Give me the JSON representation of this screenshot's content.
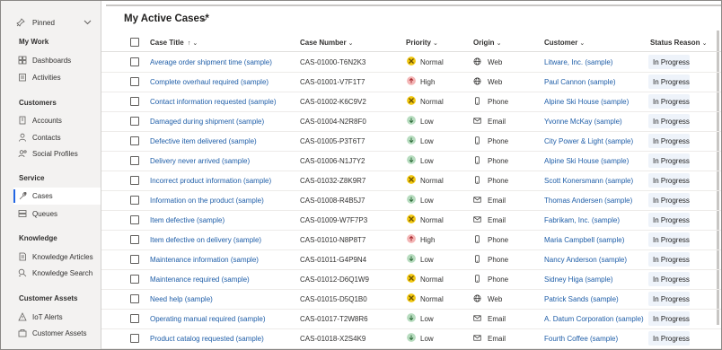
{
  "sidebar": {
    "pinned_label": "Pinned",
    "groups": [
      {
        "label": "My Work",
        "items": [
          {
            "label": "Dashboards",
            "icon": "dashboard-icon"
          },
          {
            "label": "Activities",
            "icon": "activities-icon"
          }
        ]
      },
      {
        "label": "Customers",
        "items": [
          {
            "label": "Accounts",
            "icon": "building-icon"
          },
          {
            "label": "Contacts",
            "icon": "person-icon"
          },
          {
            "label": "Social Profiles",
            "icon": "social-profile-icon"
          }
        ]
      },
      {
        "label": "Service",
        "items": [
          {
            "label": "Cases",
            "icon": "wrench-icon",
            "active": true
          },
          {
            "label": "Queues",
            "icon": "queue-icon"
          }
        ]
      },
      {
        "label": "Knowledge",
        "items": [
          {
            "label": "Knowledge Articles",
            "icon": "article-icon"
          },
          {
            "label": "Knowledge Search",
            "icon": "search-icon"
          }
        ]
      },
      {
        "label": "Customer Assets",
        "items": [
          {
            "label": "IoT Alerts",
            "icon": "iot-alert-icon"
          },
          {
            "label": "Customer Assets",
            "icon": "asset-icon"
          }
        ]
      }
    ]
  },
  "view": {
    "title": "My Active Cases*"
  },
  "columns": {
    "title": "Case Title",
    "title_sort": "↑",
    "number": "Case Number",
    "priority": "Priority",
    "origin": "Origin",
    "customer": "Customer",
    "status": "Status Reason"
  },
  "rows": [
    {
      "title": "Average order shipment time (sample)",
      "number": "CAS-01000-T6N2K3",
      "priority": "Normal",
      "origin": "Web",
      "customer": "Litware, Inc. (sample)",
      "status": "In Progress"
    },
    {
      "title": "Complete overhaul required (sample)",
      "number": "CAS-01001-V7F1T7",
      "priority": "High",
      "origin": "Web",
      "customer": "Paul Cannon (sample)",
      "status": "In Progress"
    },
    {
      "title": "Contact information requested (sample)",
      "number": "CAS-01002-K6C9V2",
      "priority": "Normal",
      "origin": "Phone",
      "customer": "Alpine Ski House (sample)",
      "status": "In Progress"
    },
    {
      "title": "Damaged during shipment (sample)",
      "number": "CAS-01004-N2R8F0",
      "priority": "Low",
      "origin": "Email",
      "customer": "Yvonne McKay (sample)",
      "status": "In Progress"
    },
    {
      "title": "Defective item delivered (sample)",
      "number": "CAS-01005-P3T6T7",
      "priority": "Low",
      "origin": "Phone",
      "customer": "City Power & Light (sample)",
      "status": "In Progress"
    },
    {
      "title": "Delivery never arrived (sample)",
      "number": "CAS-01006-N1J7Y2",
      "priority": "Low",
      "origin": "Phone",
      "customer": "Alpine Ski House (sample)",
      "status": "In Progress"
    },
    {
      "title": "Incorrect product information (sample)",
      "number": "CAS-01032-Z8K9R7",
      "priority": "Normal",
      "origin": "Phone",
      "customer": "Scott Konersmann (sample)",
      "status": "In Progress"
    },
    {
      "title": "Information on the product (sample)",
      "number": "CAS-01008-R4B5J7",
      "priority": "Low",
      "origin": "Email",
      "customer": "Thomas Andersen (sample)",
      "status": "In Progress"
    },
    {
      "title": "Item defective (sample)",
      "number": "CAS-01009-W7F7P3",
      "priority": "Normal",
      "origin": "Email",
      "customer": "Fabrikam, Inc. (sample)",
      "status": "In Progress"
    },
    {
      "title": "Item defective on delivery (sample)",
      "number": "CAS-01010-N8P8T7",
      "priority": "High",
      "origin": "Phone",
      "customer": "Maria Campbell (sample)",
      "status": "In Progress"
    },
    {
      "title": "Maintenance information (sample)",
      "number": "CAS-01011-G4P9N4",
      "priority": "Low",
      "origin": "Phone",
      "customer": "Nancy Anderson (sample)",
      "status": "In Progress"
    },
    {
      "title": "Maintenance required (sample)",
      "number": "CAS-01012-D6Q1W9",
      "priority": "Normal",
      "origin": "Phone",
      "customer": "Sidney Higa (sample)",
      "status": "In Progress"
    },
    {
      "title": "Need help (sample)",
      "number": "CAS-01015-D5Q1B0",
      "priority": "Normal",
      "origin": "Web",
      "customer": "Patrick Sands (sample)",
      "status": "In Progress"
    },
    {
      "title": "Operating manual required (sample)",
      "number": "CAS-01017-T2W8R6",
      "priority": "Low",
      "origin": "Email",
      "customer": "A. Datum Corporation (sample)",
      "status": "In Progress"
    },
    {
      "title": "Product catalog requested (sample)",
      "number": "CAS-01018-X2S4K9",
      "priority": "Low",
      "origin": "Email",
      "customer": "Fourth Coffee (sample)",
      "status": "In Progress"
    }
  ],
  "colors": {
    "link": "#1f5ea8",
    "priority_normal": "#f2c811",
    "priority_high": "#f4b6b6",
    "priority_low": "#b7dcbf",
    "status_bg": "#eef3fa"
  }
}
